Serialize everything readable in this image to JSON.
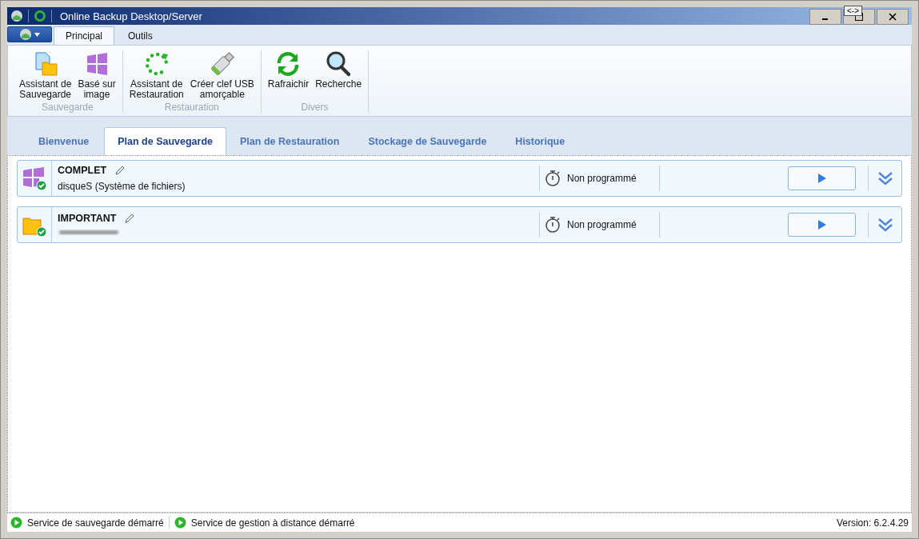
{
  "window": {
    "title": "Online Backup Desktop/Server",
    "tooltip": "<->"
  },
  "ribbon_tabs": [
    {
      "label": "Principal",
      "selected": true
    },
    {
      "label": "Outils",
      "selected": false
    }
  ],
  "ribbon_groups": [
    {
      "label": "Sauvegarde",
      "buttons": [
        {
          "kind": "backup",
          "label": "Assistant de\nSauvegarde"
        },
        {
          "kind": "image",
          "label": "Basé sur\nimage"
        }
      ]
    },
    {
      "label": "Restauration",
      "buttons": [
        {
          "kind": "restore",
          "label": "Assistant de\nRestauration"
        },
        {
          "kind": "usb",
          "label": "Créer clef USB\namorçable"
        }
      ]
    },
    {
      "label": "Divers",
      "buttons": [
        {
          "kind": "refresh",
          "label": "Rafraichir"
        },
        {
          "kind": "search",
          "label": "Recherche"
        }
      ]
    }
  ],
  "tabs": [
    {
      "label": "Bienvenue",
      "selected": false
    },
    {
      "label": "Plan de Sauvegarde",
      "selected": true
    },
    {
      "label": "Plan de Restauration",
      "selected": false
    },
    {
      "label": "Stockage de Sauvegarde",
      "selected": false
    },
    {
      "label": "Historique",
      "selected": false
    }
  ],
  "plans": [
    {
      "kind": "image",
      "name": "COMPLET",
      "source": "disqueS (Système de fichiers)",
      "schedule": "Non programmé"
    },
    {
      "kind": "files",
      "name": "IMPORTANT",
      "source_hidden": true,
      "schedule": "Non programmé"
    }
  ],
  "status_bar": {
    "items": [
      {
        "label": "Service de sauvegarde démarré"
      },
      {
        "label": "Service de gestion à distance démarré"
      }
    ],
    "version": "Version: 6.2.4.29"
  }
}
